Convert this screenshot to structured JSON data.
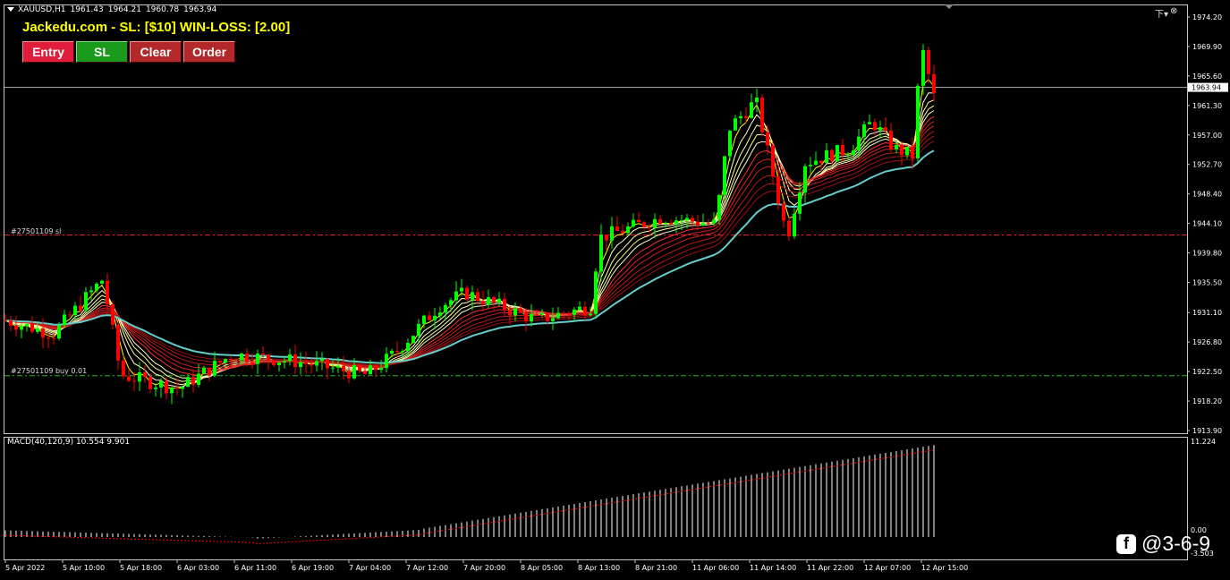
{
  "header": {
    "symbol": "XAUUSD,H1",
    "ohlc": [
      "1961.43",
      "1964.21",
      "1960.78",
      "1963.94"
    ],
    "window_icons": [
      "下▾",
      "⊗"
    ]
  },
  "banner": {
    "text": "Jackedu.com - SL: [$10] WIN-LOSS: [2.00]"
  },
  "buttons": {
    "entry": "Entry",
    "sl": "SL",
    "clear": "Clear",
    "order": "Order"
  },
  "lines": {
    "sl_label": "#27501109 sl",
    "buy_label": "#27501109 buy 0.01",
    "sl_price": 1942.4,
    "buy_price": 1921.9,
    "bid_price": 1963.94
  },
  "price_axis": {
    "ticks": [
      "1974.20",
      "1969.90",
      "1965.60",
      "1961.30",
      "1957.00",
      "1952.70",
      "1948.40",
      "1944.10",
      "1939.80",
      "1935.50",
      "1931.10",
      "1926.80",
      "1922.50",
      "1918.20",
      "1913.90"
    ],
    "current_label": "1963.94",
    "min": 1913.9,
    "max": 1974.2
  },
  "macd": {
    "label": "MACD(40,120,9) 10.554 9.901",
    "axis_ticks": [
      "11.224",
      "0.00",
      "-3.503"
    ]
  },
  "time_axis": {
    "ticks": [
      "5 Apr 2022",
      "5 Apr 10:00",
      "5 Apr 18:00",
      "6 Apr 03:00",
      "6 Apr 11:00",
      "6 Apr 19:00",
      "7 Apr 04:00",
      "7 Apr 12:00",
      "7 Apr 20:00",
      "8 Apr 05:00",
      "8 Apr 13:00",
      "8 Apr 21:00",
      "11 Apr 06:00",
      "11 Apr 14:00",
      "11 Apr 22:00",
      "12 Apr 07:00",
      "12 Apr 15:00"
    ]
  },
  "colors": {
    "bull": "#00ff00",
    "bear": "#ff0000",
    "ma_fast": "#ffff00",
    "ma_slow": "#66cccc",
    "macd_bar": "#ffffff",
    "macd_signal": "#ff0000"
  },
  "watermark": {
    "icon": "facebook-icon",
    "handle": "@3-6-9"
  }
}
